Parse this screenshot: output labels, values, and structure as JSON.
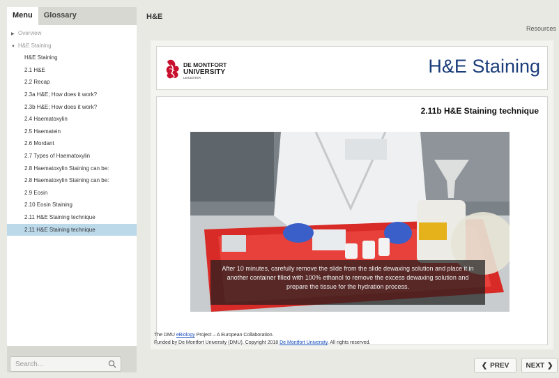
{
  "sidebar": {
    "tabs": [
      "Menu",
      "Glossary"
    ],
    "items": [
      {
        "label": "Overview"
      },
      {
        "label": "H&E Staining"
      },
      {
        "label": "H&E Staining"
      },
      {
        "label": "2.1 H&E"
      },
      {
        "label": "2.2 Recap"
      },
      {
        "label": "2.3a H&E; How does it work?"
      },
      {
        "label": "2.3b H&E; How does it work?"
      },
      {
        "label": "2.4 Haematoxylin"
      },
      {
        "label": "2.5 Haematein"
      },
      {
        "label": "2.6 Mordant"
      },
      {
        "label": "2.7 Types of Haematoxylin"
      },
      {
        "label": "2.8 Haematoxylin Staining can be:"
      },
      {
        "label": "2.8 Haematoxylin Staining can be:"
      },
      {
        "label": "2.9 Eosin"
      },
      {
        "label": "2.10 Eosin Staining"
      },
      {
        "label": "2.11 H&E Staining technique"
      },
      {
        "label": "2.11 H&E Staining technique"
      }
    ],
    "search_placeholder": "Search..."
  },
  "header": {
    "title": "H&E",
    "resources": "Resources"
  },
  "banner": {
    "logo_line1": "DE MONTFORT",
    "logo_line2": "UNIVERSITY",
    "logo_line3": "LEICESTER",
    "title": "H&E Staining"
  },
  "slide": {
    "subtitle": "2.11b H&E Staining technique",
    "caption": "After 10 minutes, carefully remove the slide from the slide dewaxing solution and place it in another container filled with 100% ethanol to remove the excess dewaxing solution and prepare the tissue for the hydration process."
  },
  "footer": {
    "line1_pre": "The DMU ",
    "line1_link": "eBiology",
    "line1_post": " Project – A European Collaboration.",
    "line2_pre": "Funded by De Montfort University (DMU). Copyright 2018 ",
    "line2_link": "De Montfort University",
    "line2_post": ". All rights reserved."
  },
  "nav": {
    "prev": "PREV",
    "next": "NEXT"
  },
  "colors": {
    "title_blue": "#1b3d7a",
    "selected_row": "#bcd9ea",
    "logo_red": "#c8102e"
  }
}
